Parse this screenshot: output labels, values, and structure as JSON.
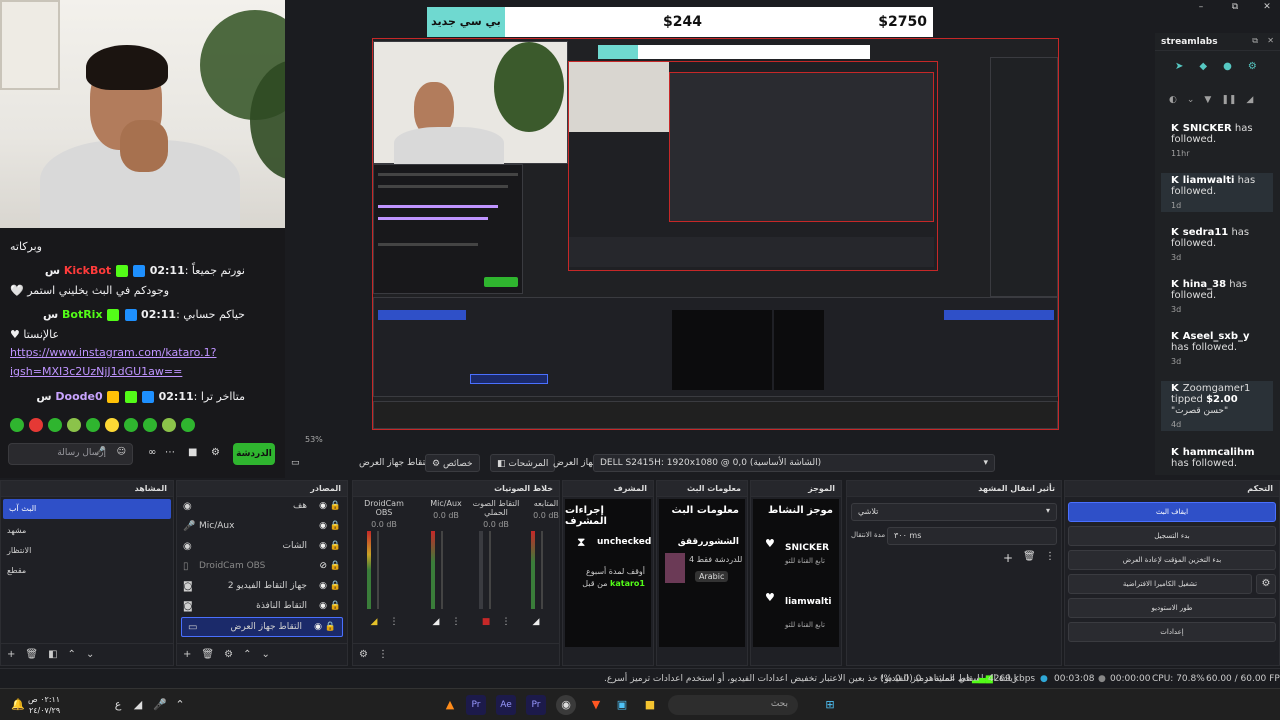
{
  "window": {
    "min": "–",
    "max": "⧉",
    "close": "✕"
  },
  "overlay": {
    "tag": "بي سي جديد",
    "value1": "$244",
    "value2": "$2750"
  },
  "chat": {
    "lines": [
      {
        "text": "وبركاته"
      },
      {
        "name": "KickBot",
        "name_color": "#ff3b3b",
        "time": "02:11 س",
        "msg": "نورتم جميعاً"
      },
      {
        "msg2": "وجودكم في البث يخليني استمر 🤍"
      },
      {
        "name": "BotRix",
        "name_color": "#53fc18",
        "time": "02:11 س",
        "msg": "حياكم حسابي"
      },
      {
        "msg2": "عالإنستا ♥"
      },
      {
        "link": "https://www.instagram.com/kataro.1?"
      },
      {
        "link": "igsh=MXI3c2UzNjJ1dGU1aw=="
      },
      {
        "name": "Doode0",
        "name_color": "#c9a4ff",
        "time": "02:11 س",
        "msg": "متااخر ترا"
      }
    ],
    "input_placeholder": "إرسال رسالة",
    "send_label": "الدردشة"
  },
  "streamlabs": {
    "title": "streamlabs",
    "alerts": [
      {
        "name": "SNICKER",
        "action": "has followed.",
        "time": "11hr",
        "highlight": false
      },
      {
        "name": "liamwalti",
        "action": "has followed.",
        "time": "1d",
        "highlight": true
      },
      {
        "name": "sedra11",
        "action": "has followed.",
        "time": "3d",
        "highlight": false
      },
      {
        "name": "hina_38",
        "action": "has followed.",
        "time": "3d",
        "highlight": false
      },
      {
        "name": "Aseel_sxb_y",
        "action": "has followed.",
        "time": "3d",
        "highlight": false
      },
      {
        "name": "Zoomgamer1",
        "action": "tipped",
        "amount": "$2.00",
        "note": "\"حسن قصرت\"",
        "time": "4d",
        "highlight": true
      },
      {
        "name": "hammcalihm",
        "action": "has followed.",
        "time": "",
        "highlight": false
      }
    ]
  },
  "preview_toolbar": {
    "zoom": "53%",
    "properties": "خصائص",
    "filters": "المرشحات",
    "display_capture": "التقاط جهاز العرض",
    "device_label": "جهاز العرض",
    "device_value": "DELL S2415H: 1920x1080 @ 0,0 (الشاشة الأساسية)"
  },
  "docks": {
    "scenes": {
      "title": "المشاهد",
      "items": [
        "البث آب",
        "مشهد",
        "الانتظار",
        "مقطع"
      ]
    },
    "sources": {
      "title": "المصادر",
      "items": [
        {
          "label": "هف",
          "icon": "globe",
          "visible": true
        },
        {
          "label": "Mic/Aux",
          "icon": "mic",
          "visible": true
        },
        {
          "label": "الشات",
          "icon": "globe",
          "visible": true
        },
        {
          "label": "DroidCam OBS",
          "icon": "file",
          "visible": false
        },
        {
          "label": "جهاز التقاط الفيديو 2",
          "icon": "camera",
          "visible": true
        },
        {
          "label": "التقاط النافذة",
          "icon": "camera",
          "visible": true
        },
        {
          "label": "التقاط جهاز العرض",
          "icon": "monitor",
          "visible": true
        }
      ]
    },
    "mixer": {
      "title": "خلاط الصوتيات",
      "channels": [
        {
          "name": "DroidCam OBS",
          "db": "0.0 dB"
        },
        {
          "name": "Mic/Aux",
          "db": "0.0 dB"
        },
        {
          "name": "التقاط الصوت الحملي",
          "db": "0.0 dB"
        },
        {
          "name": "المتابعه",
          "db": "0.0 dB"
        }
      ]
    },
    "mod": {
      "title": "المشرف",
      "heading": "إجراءات المشرف",
      "status": "unchecked",
      "line1": "أوقف لمدة أسبوع",
      "line2": "من قبل",
      "user": "kataro1"
    },
    "info": {
      "title": "معلومات البث",
      "heading": "معلومات البث",
      "stream_title": "الششوررققق",
      "sub": "للدردشة فقط 4",
      "lang": "Arabic"
    },
    "summary": {
      "title": "الموجز",
      "heading": "موجز النشاط",
      "items": [
        {
          "name": "SNICKER",
          "sub": "تابع القناة للتو"
        },
        {
          "name": "liamwalti",
          "sub": "تابع القناة للتو"
        }
      ]
    },
    "transitions": {
      "title": "تأثير انتقال المشهد",
      "type": "تلاشي",
      "duration_label": "مدة الانتقال",
      "duration_value": "٣٠٠ ms"
    },
    "controls": {
      "title": "التحكم",
      "buttons": [
        "ايقاف البث",
        "بدء التسجيل",
        "بدء التخزين المؤقت لإعادة العرض",
        "تشغيل الكاميرا الافتراضية",
        "طور الاستوديو",
        "إعدادات"
      ]
    }
  },
  "status": {
    "warning": "زيادة الحمل في عملية ترميز الفيديو! خذ بعين الاعتبار تخفيض اعدادات الفيديو، أو استخدم اعدادات ترميز أسرع.",
    "dropped": "إسقاط المشاهد 0 (0.0 %)",
    "bitrate": "4269 kbps",
    "live": "00:03:08",
    "rec": "00:00:00",
    "cpu": "CPU: 70.8%",
    "fps": "60.00 / 60.00 FPS"
  },
  "taskbar": {
    "search": "بحث",
    "time": "٠٢:١١ ص",
    "date": "٢٤/٠٧/٢٩",
    "lang": "ع"
  }
}
